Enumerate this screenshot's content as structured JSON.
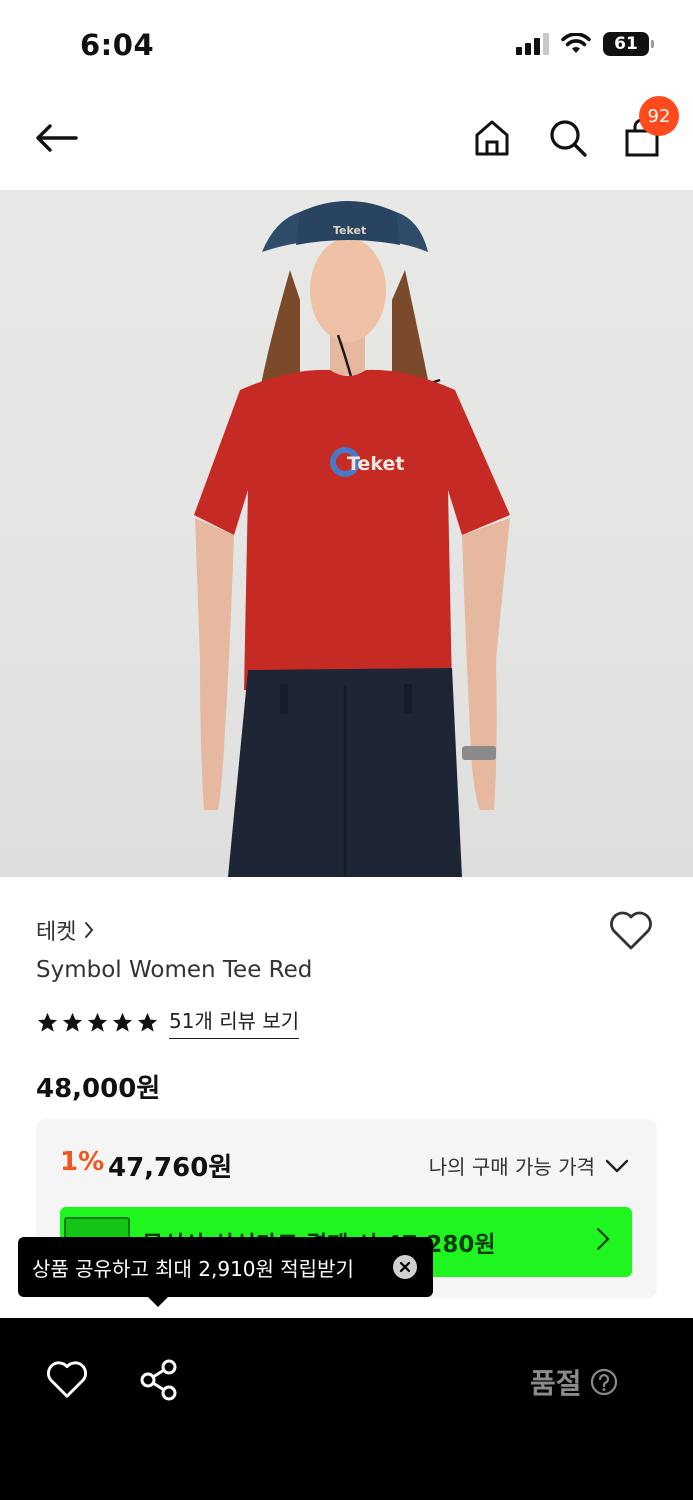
{
  "status_bar": {
    "time": "6:04",
    "battery": "61"
  },
  "header": {
    "back_icon": "arrow-left-icon",
    "home_icon": "home-icon",
    "search_icon": "search-icon",
    "cart_icon": "shopping-bag-icon",
    "cart_badge": "92",
    "badge_color": "#ff4a1c"
  },
  "product": {
    "image_description": "Model wearing red tee with blue Teket logo, denim bucket hat and navy trousers",
    "brand": "테켓",
    "name": "Symbol Women Tee Red",
    "rating_stars": 5,
    "review_link": "51개 리뷰 보기",
    "original_price": "48,000원"
  },
  "price_box": {
    "discount_rate": "1%",
    "discount_price": "47,760원",
    "my_price_label": "나의 구매 가능 가격",
    "card_banner_text": "무신사 삼성카드 결제 시 47,280원",
    "accent_color": "#f1561e",
    "banner_color": "#1ff61f"
  },
  "tooltip": {
    "text": "상품 공유하고 최대 2,910원 적립받기"
  },
  "bottom_bar": {
    "wish_icon": "heart-icon",
    "share_icon": "share-icon",
    "soldout_label": "품절",
    "help_icon": "question-circle-icon"
  }
}
